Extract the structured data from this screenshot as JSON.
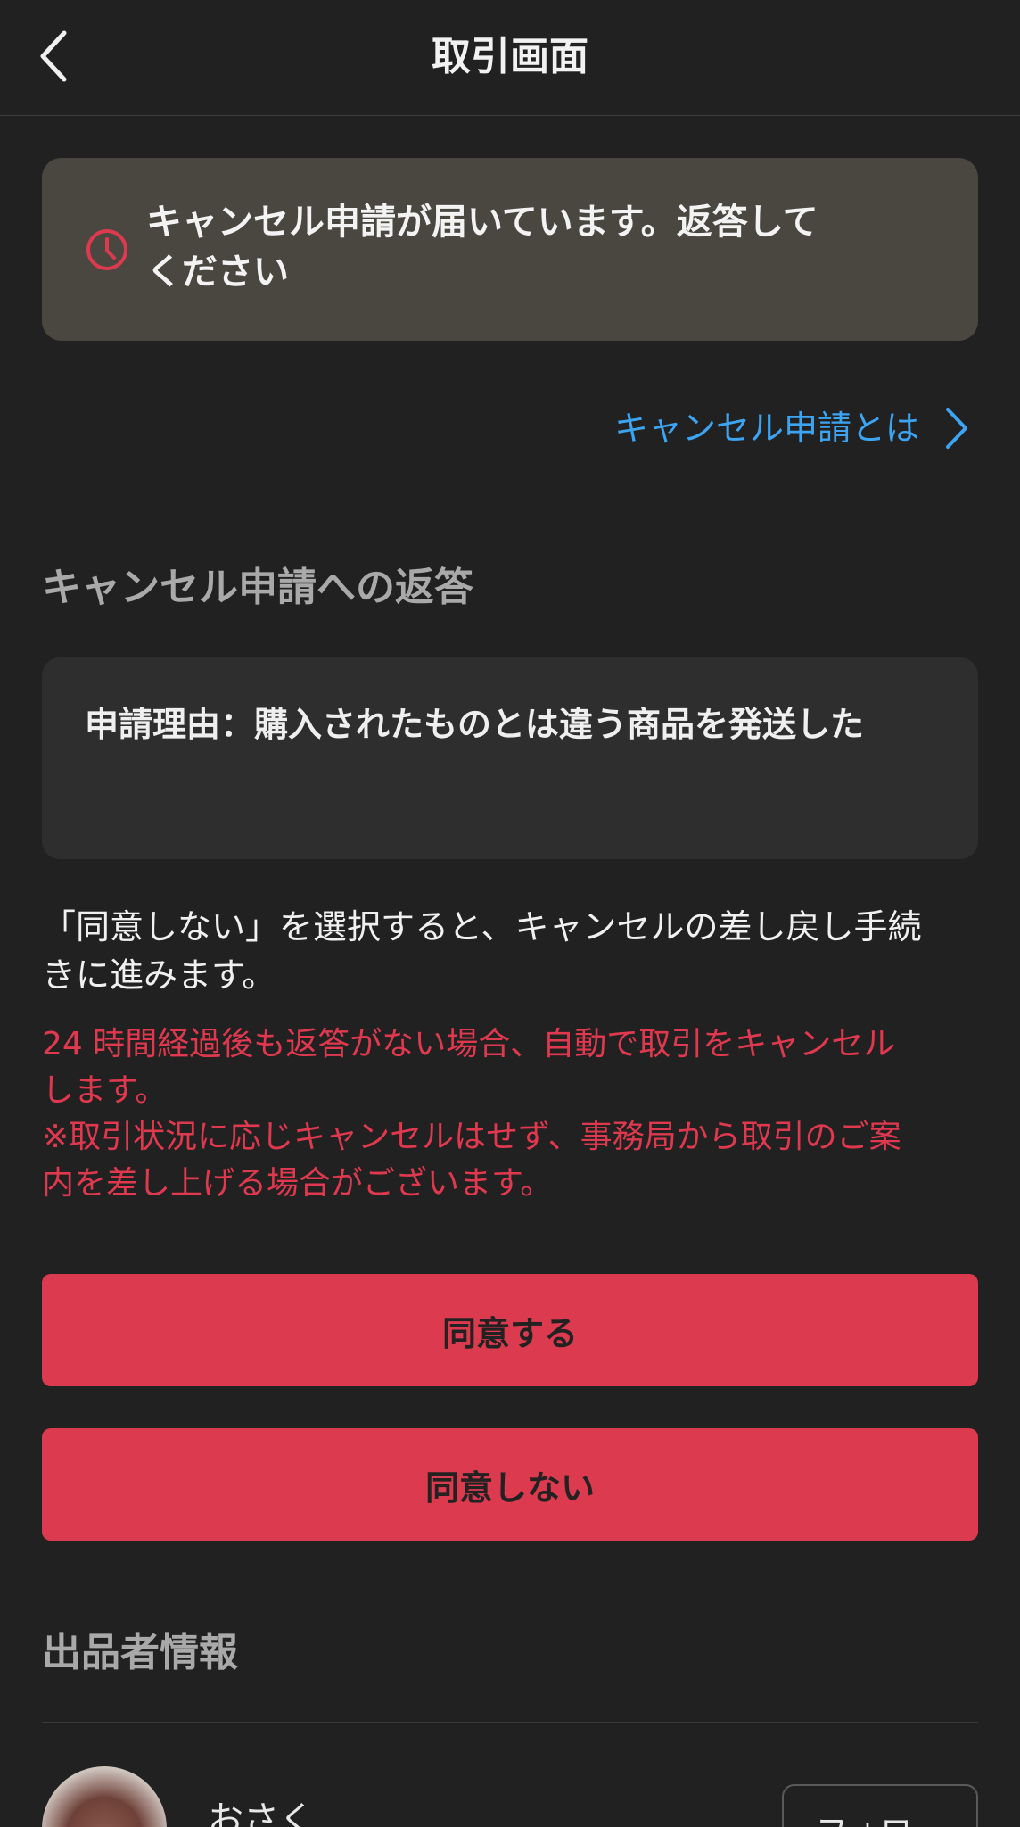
{
  "header": {
    "title": "取引画面",
    "back_icon": "chevron-left-icon"
  },
  "notice": {
    "icon": "clock-icon",
    "line1": "キャンセル申請が届いています。返答して",
    "line2": "ください",
    "accent_color": "#dc3a4e"
  },
  "help_link": {
    "label": "キャンセル申請とは",
    "icon": "chevron-right-icon",
    "color": "#3da4f2"
  },
  "response_section": {
    "title": "キャンセル申請への返答",
    "reason": "申請理由：購入されたものとは違う商品を発送した",
    "info_line1": "「同意しない」を選択すると、キャンセルの差し戻し手続",
    "info_line2": "きに進みます。",
    "warning_lines": [
      "24 時間経過後も返答がない場合、自動で取引をキャンセル",
      "します。",
      "※取引状況に応じキャンセルはせず、事務局から取引のご案",
      "内を差し上げる場合がございます。"
    ],
    "agree_button": "同意する",
    "disagree_button": "同意しない"
  },
  "seller_section": {
    "title": "出品者情報",
    "name": "おさく",
    "follow_button": "フォロー"
  }
}
